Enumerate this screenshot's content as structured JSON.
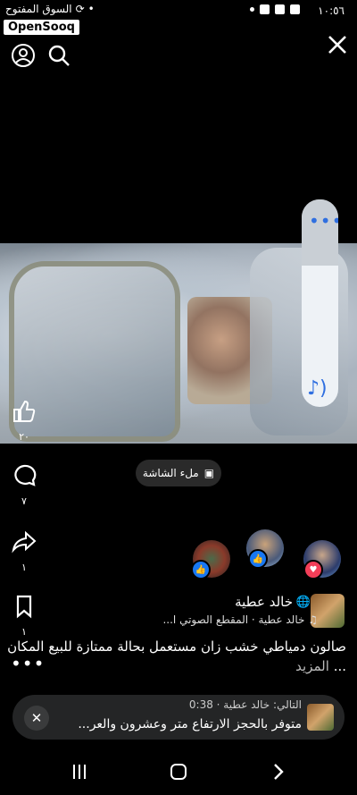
{
  "status_bar": {
    "time": "١٠:٥٦",
    "left_text": "السوق المفتوح",
    "brand": "OpenSooq"
  },
  "top_bar": {
    "profile_icon": "profile-icon",
    "search_icon": "search-icon",
    "close_icon": "close-icon"
  },
  "actions": {
    "like_count": "٢٠",
    "comment_count": "٧",
    "share_count": "١",
    "save_count": "١"
  },
  "fill_screen_label": "ملء الشاشة",
  "volume": {
    "level": 0.68
  },
  "post": {
    "author": "خالد عطية",
    "audio_line": "خالد عطية · المقطع الصوتي ا...",
    "caption": "صالون دمياطي خشب زان مستعمل بحالة ممتازة للبيع المكان ...",
    "more": "المزيد"
  },
  "next_up": {
    "label": "التالي: خالد عطية · 0:38",
    "title": "متوفر بالحجز  الارتفاع متر وعشرون والعر..."
  },
  "colors": {
    "accent": "#2f6fe0",
    "like": "#1877f2",
    "love": "#f33e58"
  }
}
